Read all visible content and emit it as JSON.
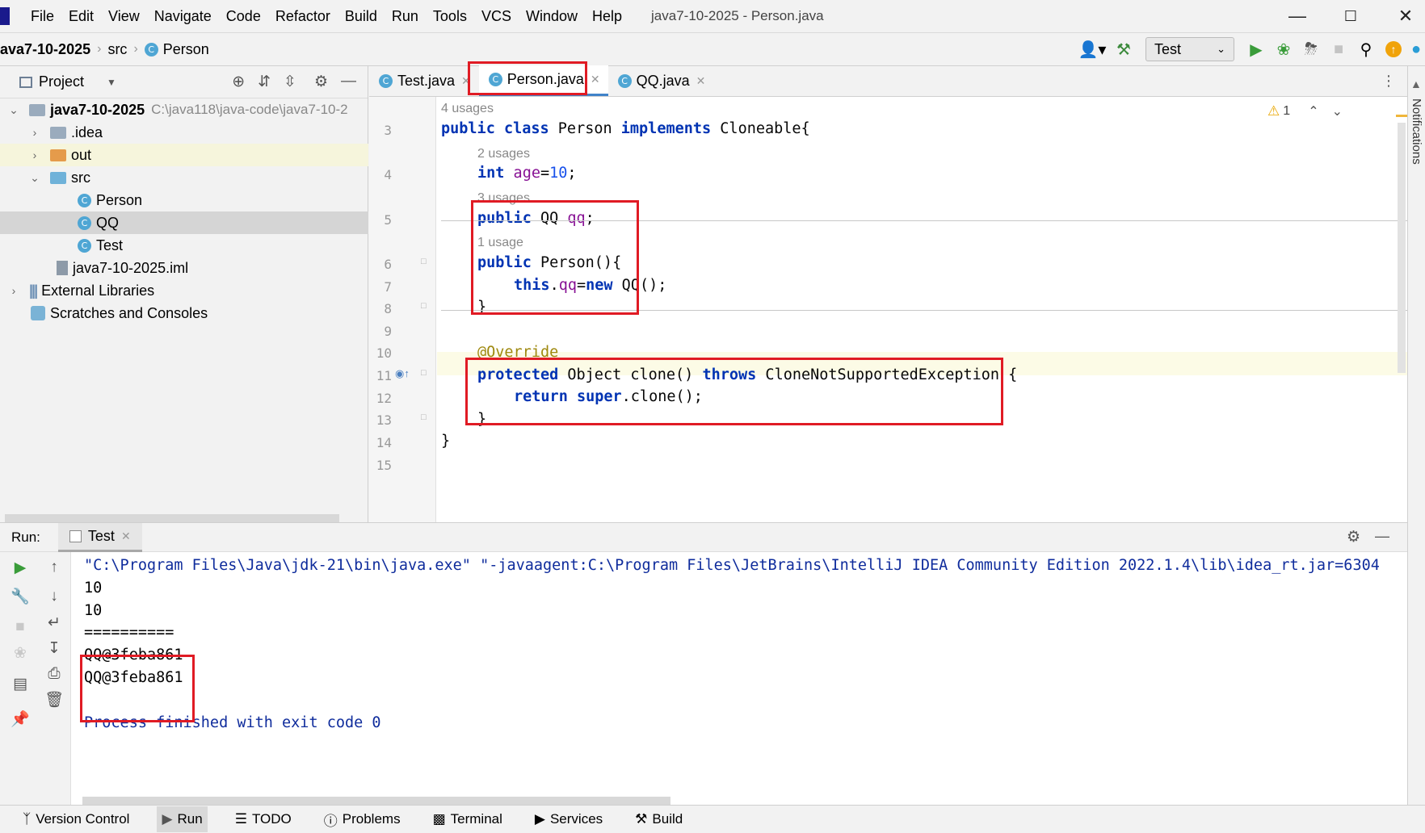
{
  "menubar": {
    "items": [
      "File",
      "Edit",
      "View",
      "Navigate",
      "Code",
      "Refactor",
      "Build",
      "Run",
      "Tools",
      "VCS",
      "Window",
      "Help"
    ],
    "title": "java7-10-2025 - Person.java"
  },
  "navbar": {
    "crumbs": [
      "ava7-10-2025",
      "src",
      "Person"
    ],
    "run_config": "Test"
  },
  "project": {
    "title": "Project",
    "tree": [
      {
        "label": "java7-10-2025",
        "path": "C:\\java118\\java-code\\java7-10-2"
      },
      {
        "label": ".idea"
      },
      {
        "label": "out"
      },
      {
        "label": "src"
      },
      {
        "label": "Person"
      },
      {
        "label": "QQ"
      },
      {
        "label": "Test"
      },
      {
        "label": "java7-10-2025.iml"
      },
      {
        "label": "External Libraries"
      },
      {
        "label": "Scratches and Consoles"
      }
    ]
  },
  "editor": {
    "tabs": [
      "Test.java",
      "Person.java",
      "QQ.java"
    ],
    "warning_count": "1",
    "hints": [
      "4 usages",
      "2 usages",
      "3 usages",
      "1 usage"
    ],
    "line_numbers": [
      "3",
      "4",
      "5",
      "6",
      "7",
      "8",
      "9",
      "10",
      "11",
      "12",
      "13",
      "14",
      "15"
    ],
    "code": {
      "l3_kw": "public class",
      "l3_rest": " Person ",
      "l3_kw2": "implements",
      "l3_end": " Cloneable{",
      "l4_kw": "int",
      "l4_fld": " age",
      "l4_eq": "=",
      "l4_num": "10",
      "l4_end": ";",
      "l5_kw": "public",
      "l5_type": " QQ ",
      "l5_fld": "qq",
      "l5_end": ";",
      "l6_kw": "public",
      "l6_rest": " Person(){",
      "l7_kw": "this",
      "l7_dot": ".",
      "l7_fld": "qq",
      "l7_eq": "=",
      "l7_kw2": "new",
      "l7_end": " QQ();",
      "l8": "}",
      "l10": "@Override",
      "l11_kw": "protected",
      "l11_mid": " Object clone() ",
      "l11_kw2": "throws",
      "l11_end": " CloneNotSupportedException {",
      "l12_kw": "return",
      "l12_kw2": " super",
      "l12_end": ".clone();",
      "l13": "}",
      "l14": "}"
    }
  },
  "notifications_label": "Notifications",
  "run": {
    "label": "Run:",
    "tab": "Test",
    "output": [
      "\"C:\\Program Files\\Java\\jdk-21\\bin\\java.exe\" \"-javaagent:C:\\Program Files\\JetBrains\\IntelliJ IDEA Community Edition 2022.1.4\\lib\\idea_rt.jar=6304",
      "10",
      "10",
      "==========",
      "QQ@3feba861",
      "QQ@3feba861",
      "Process finished with exit code 0"
    ]
  },
  "tool_stripe": [
    "Version Control",
    "Run",
    "TODO",
    "Problems",
    "Terminal",
    "Services",
    "Build"
  ],
  "colors": {
    "highlight_box": "#e01b24",
    "keyword": "#0033b3",
    "field": "#871094",
    "number": "#1750eb",
    "annotation": "#9e880d"
  }
}
